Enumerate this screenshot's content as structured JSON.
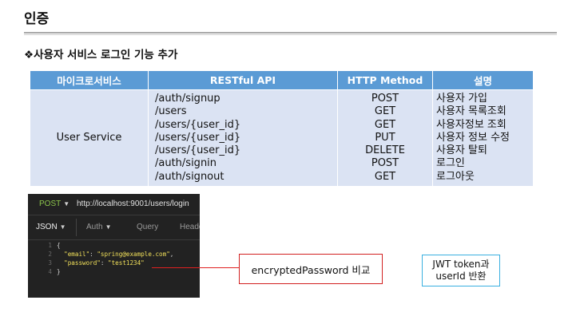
{
  "page": {
    "title": "인증",
    "section_heading": "❖사용자 서비스 로그인 기능 추가"
  },
  "table": {
    "headers": [
      "마이크로서비스",
      "RESTful API",
      "HTTP Method",
      "설명"
    ],
    "service": "User Service",
    "apis": [
      "/auth/signup",
      "/users",
      "/users/{user_id}",
      "/users/{user_id}",
      "/users/{user_id}",
      "/auth/signin",
      "/auth/signout"
    ],
    "methods": [
      "POST",
      "GET",
      "GET",
      "PUT",
      "DELETE",
      "POST",
      "GET"
    ],
    "descriptions": [
      "사용자 가입",
      "사용자 목록조회",
      "사용자정보 조회",
      "사용자 정보 수정",
      "사용자 탈퇴",
      "로그인",
      "로그아웃"
    ]
  },
  "postman": {
    "method": "POST",
    "url": "http://localhost:9001/users/login",
    "tabs": [
      "JSON",
      "Auth",
      "Query",
      "Heade"
    ],
    "code": {
      "line_numbers": [
        "1",
        "2",
        "3",
        "4"
      ],
      "open_brace": "{",
      "email_key": "\"email\"",
      "email_value": "\"spring@example.com\"",
      "password_key": "\"password\"",
      "password_value": "\"test1234\"",
      "close_brace": "}"
    }
  },
  "callouts": {
    "compare": "encryptedPassword 비교",
    "jwt_line1": "JWT token과",
    "jwt_line2": "userId 반환"
  },
  "colors": {
    "header_bg": "#5b9bd5",
    "cell_bg": "#dbe3f3",
    "callout_red": "#d22020",
    "callout_blue": "#3ab0e0",
    "editor_bg": "#222222"
  }
}
